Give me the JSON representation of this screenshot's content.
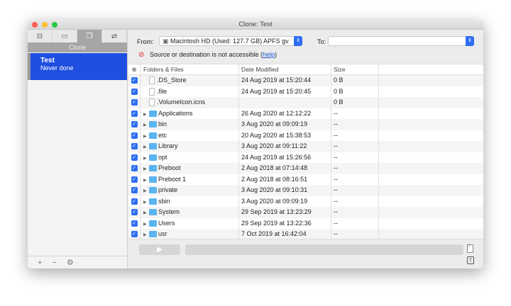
{
  "window": {
    "title": "Clone: Test"
  },
  "sidebar": {
    "tabs": [
      {
        "icon": "drawer-icon"
      },
      {
        "icon": "archive-icon"
      },
      {
        "icon": "clone-icon",
        "active": true
      },
      {
        "icon": "sync-icon"
      }
    ],
    "section": "Clone",
    "task": {
      "name": "Test",
      "status": "Never done"
    },
    "footer": {
      "add": "+",
      "remove": "−"
    }
  },
  "source": {
    "label": "From:",
    "value": "Macintosh HD (Used: 127.7 GB)  APFS gv"
  },
  "dest": {
    "label": "To:",
    "value": ""
  },
  "error": {
    "text": "Source or destination is not accessible (",
    "link": "help",
    "close": ")"
  },
  "table": {
    "headers": [
      "Folders & Files",
      "Date Modified",
      "Size"
    ],
    "rows": [
      {
        "name": ".DS_Store",
        "type": "file",
        "date": "24 Aug 2019 at 15:20:44",
        "size": "0 B"
      },
      {
        "name": ".file",
        "type": "file",
        "date": "24 Aug 2019 at 15:20:45",
        "size": "0 B"
      },
      {
        "name": ".VolumeIcon.icns",
        "type": "file",
        "date": "",
        "size": "0 B"
      },
      {
        "name": "Applications",
        "type": "folder",
        "date": "26 Aug 2020 at 12:12:22",
        "size": "--"
      },
      {
        "name": "bin",
        "type": "folder",
        "date": "3 Aug 2020 at 09:09:19",
        "size": "--"
      },
      {
        "name": "etc",
        "type": "folder",
        "date": "20 Aug 2020 at 15:38:53",
        "size": "--"
      },
      {
        "name": "Library",
        "type": "folder",
        "date": "3 Aug 2020 at 09:11:22",
        "size": "--"
      },
      {
        "name": "opt",
        "type": "folder",
        "date": "24 Aug 2019 at 15:26:56",
        "size": "--"
      },
      {
        "name": "Preboot",
        "type": "folder",
        "date": "2 Aug 2018 at 07:14:48",
        "size": "--"
      },
      {
        "name": "Preboot 1",
        "type": "folder",
        "date": "2 Aug 2018 at 08:16:51",
        "size": "--"
      },
      {
        "name": "private",
        "type": "folder",
        "date": "3 Aug 2020 at 09:10:31",
        "size": "--"
      },
      {
        "name": "sbin",
        "type": "folder",
        "date": "3 Aug 2020 at 09:09:19",
        "size": "--"
      },
      {
        "name": "System",
        "type": "folder",
        "date": "29 Sep 2019 at 13:23:29",
        "size": "--"
      },
      {
        "name": "Users",
        "type": "folder",
        "date": "29 Sep 2019 at 13:22:36",
        "size": "--"
      },
      {
        "name": "usr",
        "type": "folder",
        "date": "7 Oct 2019 at 16:42:04",
        "size": "--"
      }
    ]
  },
  "colors": {
    "accent": "#2d6ef2",
    "selection": "#1f4fe0"
  }
}
